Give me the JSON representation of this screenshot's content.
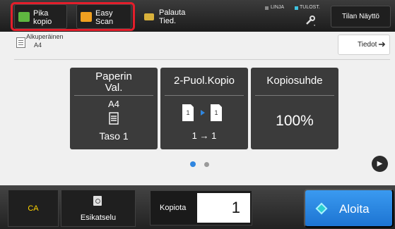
{
  "top_bar": {
    "quick_copy_label": "Pika\nkopio",
    "easy_scan_label": "Easy\nScan",
    "retrieve_label": "Palauta\nTied.",
    "line_status": "LINJA",
    "print_status": "TULOST.",
    "status_screen_label": "Tilan Näyttö"
  },
  "original": {
    "label": "Alkuperäinen",
    "size": "A4"
  },
  "details_label": "Tiedot",
  "tiles": [
    {
      "title": "Paperin\nVal.",
      "line1": "A4",
      "line2": "Taso 1"
    },
    {
      "title": "2-Puol.Kopio",
      "line2": "1 → 1"
    },
    {
      "title": "Kopiosuhde",
      "line2": "100%"
    }
  ],
  "pager": {
    "current_page": 1,
    "total_pages": 2
  },
  "bottom_bar": {
    "ca_label": "CA",
    "preview_label": "Esikatselu",
    "copies_label": "Kopiota",
    "copies_value": "1",
    "start_label": "Aloita"
  },
  "colors": {
    "highlight": "#e41e2b",
    "start_button": "#1d74d2",
    "ca_text": "#ffd400",
    "active_dot": "#2f86e0"
  }
}
